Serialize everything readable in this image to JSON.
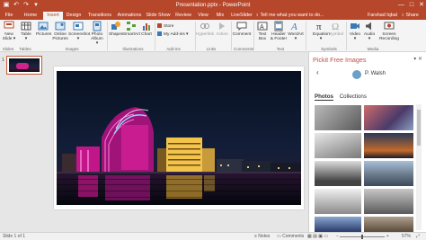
{
  "window": {
    "title": "Presentation.pptx - PowerPoint",
    "controls": [
      "—",
      "□",
      "✕"
    ]
  },
  "tabs": [
    {
      "label": "File",
      "active": false
    },
    {
      "label": "Home",
      "active": false
    },
    {
      "label": "Insert",
      "active": true
    },
    {
      "label": "Design",
      "active": false
    },
    {
      "label": "Transitions",
      "active": false
    },
    {
      "label": "Animations",
      "active": false
    },
    {
      "label": "Slide Show",
      "active": false
    },
    {
      "label": "Review",
      "active": false
    },
    {
      "label": "View",
      "active": false
    },
    {
      "label": "Mix",
      "active": false
    },
    {
      "label": "LiveSlider",
      "active": false
    }
  ],
  "tellme": "♀ Tell me what you want to do...",
  "user": "Farshad Iqbal",
  "share": "♀ Share",
  "ribbon": {
    "buttons": [
      {
        "key": "new_slide",
        "label": "New\nSlide ▾",
        "icon": "new-slide-icon"
      },
      {
        "key": "table",
        "label": "Table\n▾",
        "icon": "table-icon"
      },
      {
        "key": "pictures",
        "label": "Pictures",
        "icon": "pictures-icon"
      },
      {
        "key": "online_pictures",
        "label": "Online\nPictures",
        "icon": "online-pictures-icon"
      },
      {
        "key": "screenshot",
        "label": "Screenshot\n▾",
        "icon": "screenshot-icon"
      },
      {
        "key": "photo_album",
        "label": "Photo\nAlbum ▾",
        "icon": "photo-album-icon"
      },
      {
        "key": "shapes",
        "label": "Shapes",
        "icon": "shapes-icon"
      },
      {
        "key": "smartart",
        "label": "SmartArt",
        "icon": "smartart-icon"
      },
      {
        "key": "chart",
        "label": "Chart",
        "icon": "chart-icon"
      },
      {
        "key": "hyperlink",
        "label": "Hyperlink",
        "icon": "hyperlink-icon"
      },
      {
        "key": "action",
        "label": "Action",
        "icon": "action-icon"
      },
      {
        "key": "comment",
        "label": "Comment",
        "icon": "comment-icon"
      },
      {
        "key": "text_box",
        "label": "Text\nBox",
        "icon": "text-box-icon"
      },
      {
        "key": "header_footer",
        "label": "Header\n& Footer",
        "icon": "header-footer-icon"
      },
      {
        "key": "wordart",
        "label": "WordArt\n▾",
        "icon": "wordart-icon"
      },
      {
        "key": "equation",
        "label": "Equation\n▾",
        "icon": "equation-icon"
      },
      {
        "key": "symbol",
        "label": "Symbol",
        "icon": "symbol-icon"
      },
      {
        "key": "video",
        "label": "Video\n▾",
        "icon": "video-icon"
      },
      {
        "key": "audio",
        "label": "Audio\n▾",
        "icon": "audio-icon"
      },
      {
        "key": "screen_recording",
        "label": "Screen\nRecording",
        "icon": "screen-recording-icon"
      }
    ],
    "addins": {
      "store": "Store",
      "my_addins": "My Add-ins ▾"
    },
    "groups": [
      "Slides",
      "Tables",
      "Images",
      "Illustrations",
      "Add-ins",
      "Links",
      "Comments",
      "Text",
      "Symbols",
      "Media"
    ]
  },
  "slides_panel": {
    "number": "1"
  },
  "pane": {
    "title": "Pickit Free Images",
    "controls": "▾ ✕",
    "back": "‹",
    "author": "P. Walsh",
    "tabs": [
      {
        "label": "Photos",
        "active": true
      },
      {
        "label": "Collections",
        "active": false
      }
    ]
  },
  "status": {
    "slide": "Slide 1 of 1",
    "notes": "≡ Notes",
    "comments": "▭ Comments",
    "zoom": "57%"
  },
  "colors": {
    "accent": "#b7472a",
    "pane_title": "#c0504d",
    "ribbon_bg": "#f4f4f4"
  }
}
